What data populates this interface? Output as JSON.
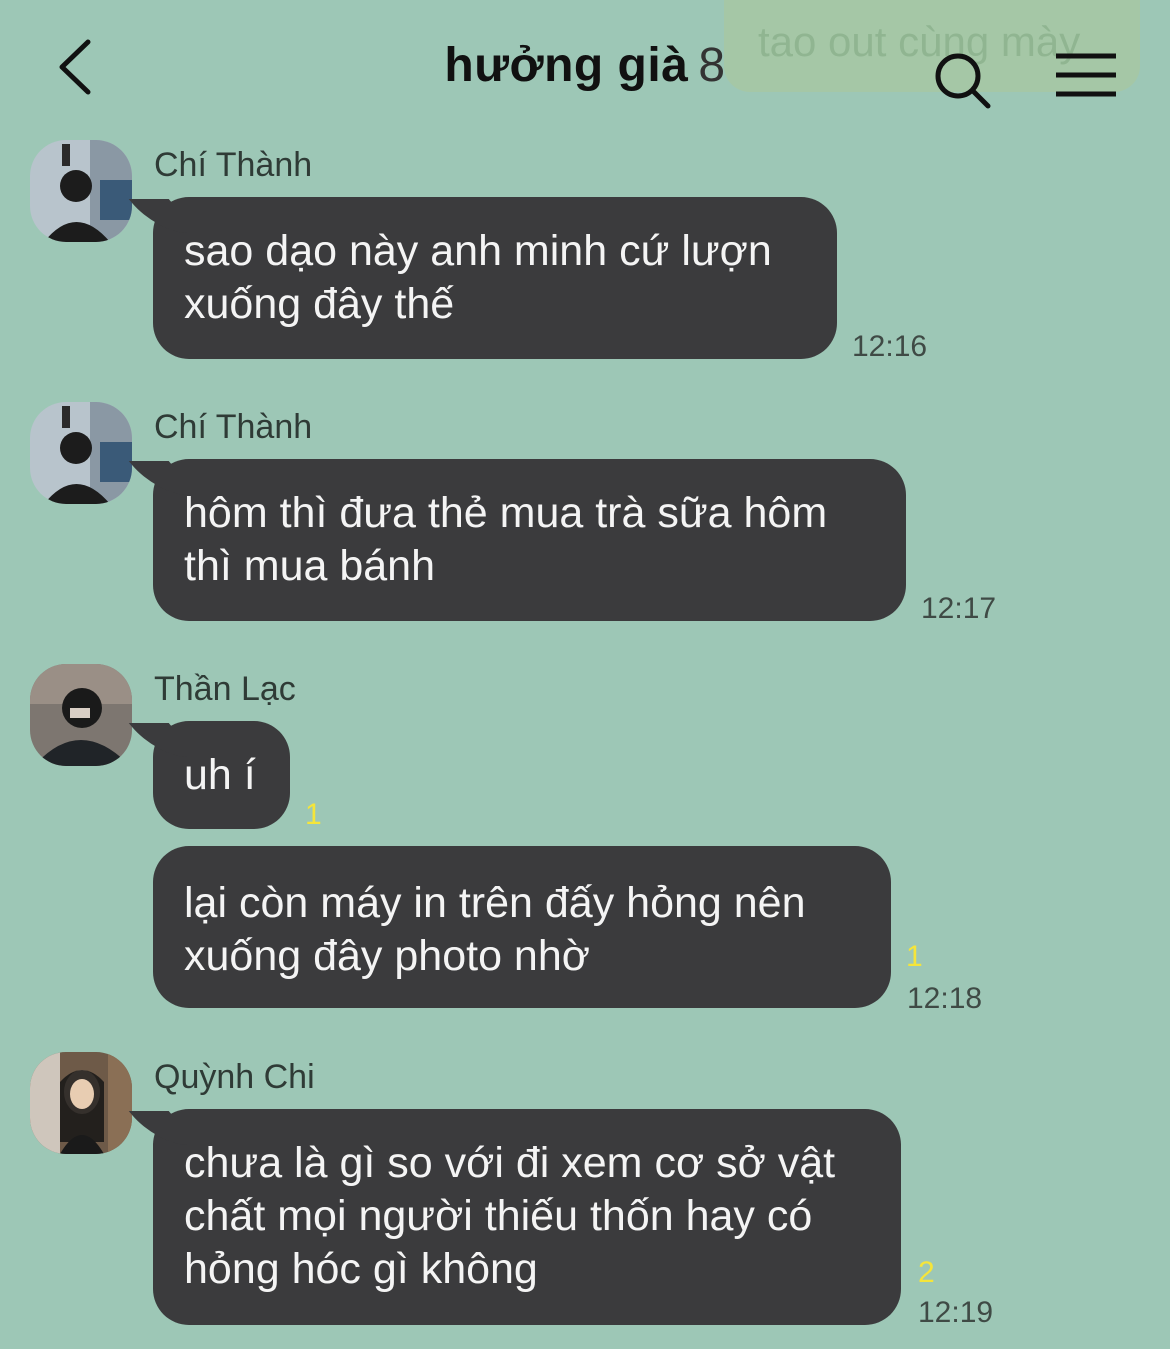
{
  "header": {
    "title": "hưởng già",
    "member_count": "8",
    "ghost_preview_text": "tao out cùng mày"
  },
  "messages": [
    {
      "sender": "Chí Thành",
      "text_lines": [
        "sao dạo này anh minh cứ lượn",
        "xuống đây thế"
      ],
      "time": "12:16",
      "unread": ""
    },
    {
      "sender": "Chí Thành",
      "text_lines": [
        "hôm thì đưa thẻ mua trà sữa hôm",
        "thì mua bánh"
      ],
      "time": "12:17",
      "unread": ""
    },
    {
      "sender": "Thần Lạc",
      "text_lines": [
        "uh í"
      ],
      "time": "",
      "unread": "1"
    },
    {
      "sender": "",
      "text_lines": [
        "lại còn máy in trên đấy hỏng nên",
        "xuống đây photo nhờ"
      ],
      "time": "12:18",
      "unread": "1"
    },
    {
      "sender": "Quỳnh Chi",
      "text_lines": [
        "chưa là gì so với đi xem cơ sở vật",
        "chất mọi người thiếu thốn hay có",
        "hỏng hóc gì không"
      ],
      "time": "12:19",
      "unread": "2"
    }
  ],
  "icons": [
    "back-icon",
    "search-icon",
    "menu-icon"
  ],
  "colors": {
    "background": "#9dc7b6",
    "bubble": "#3b3b3d",
    "unread": "#f5e53a"
  }
}
